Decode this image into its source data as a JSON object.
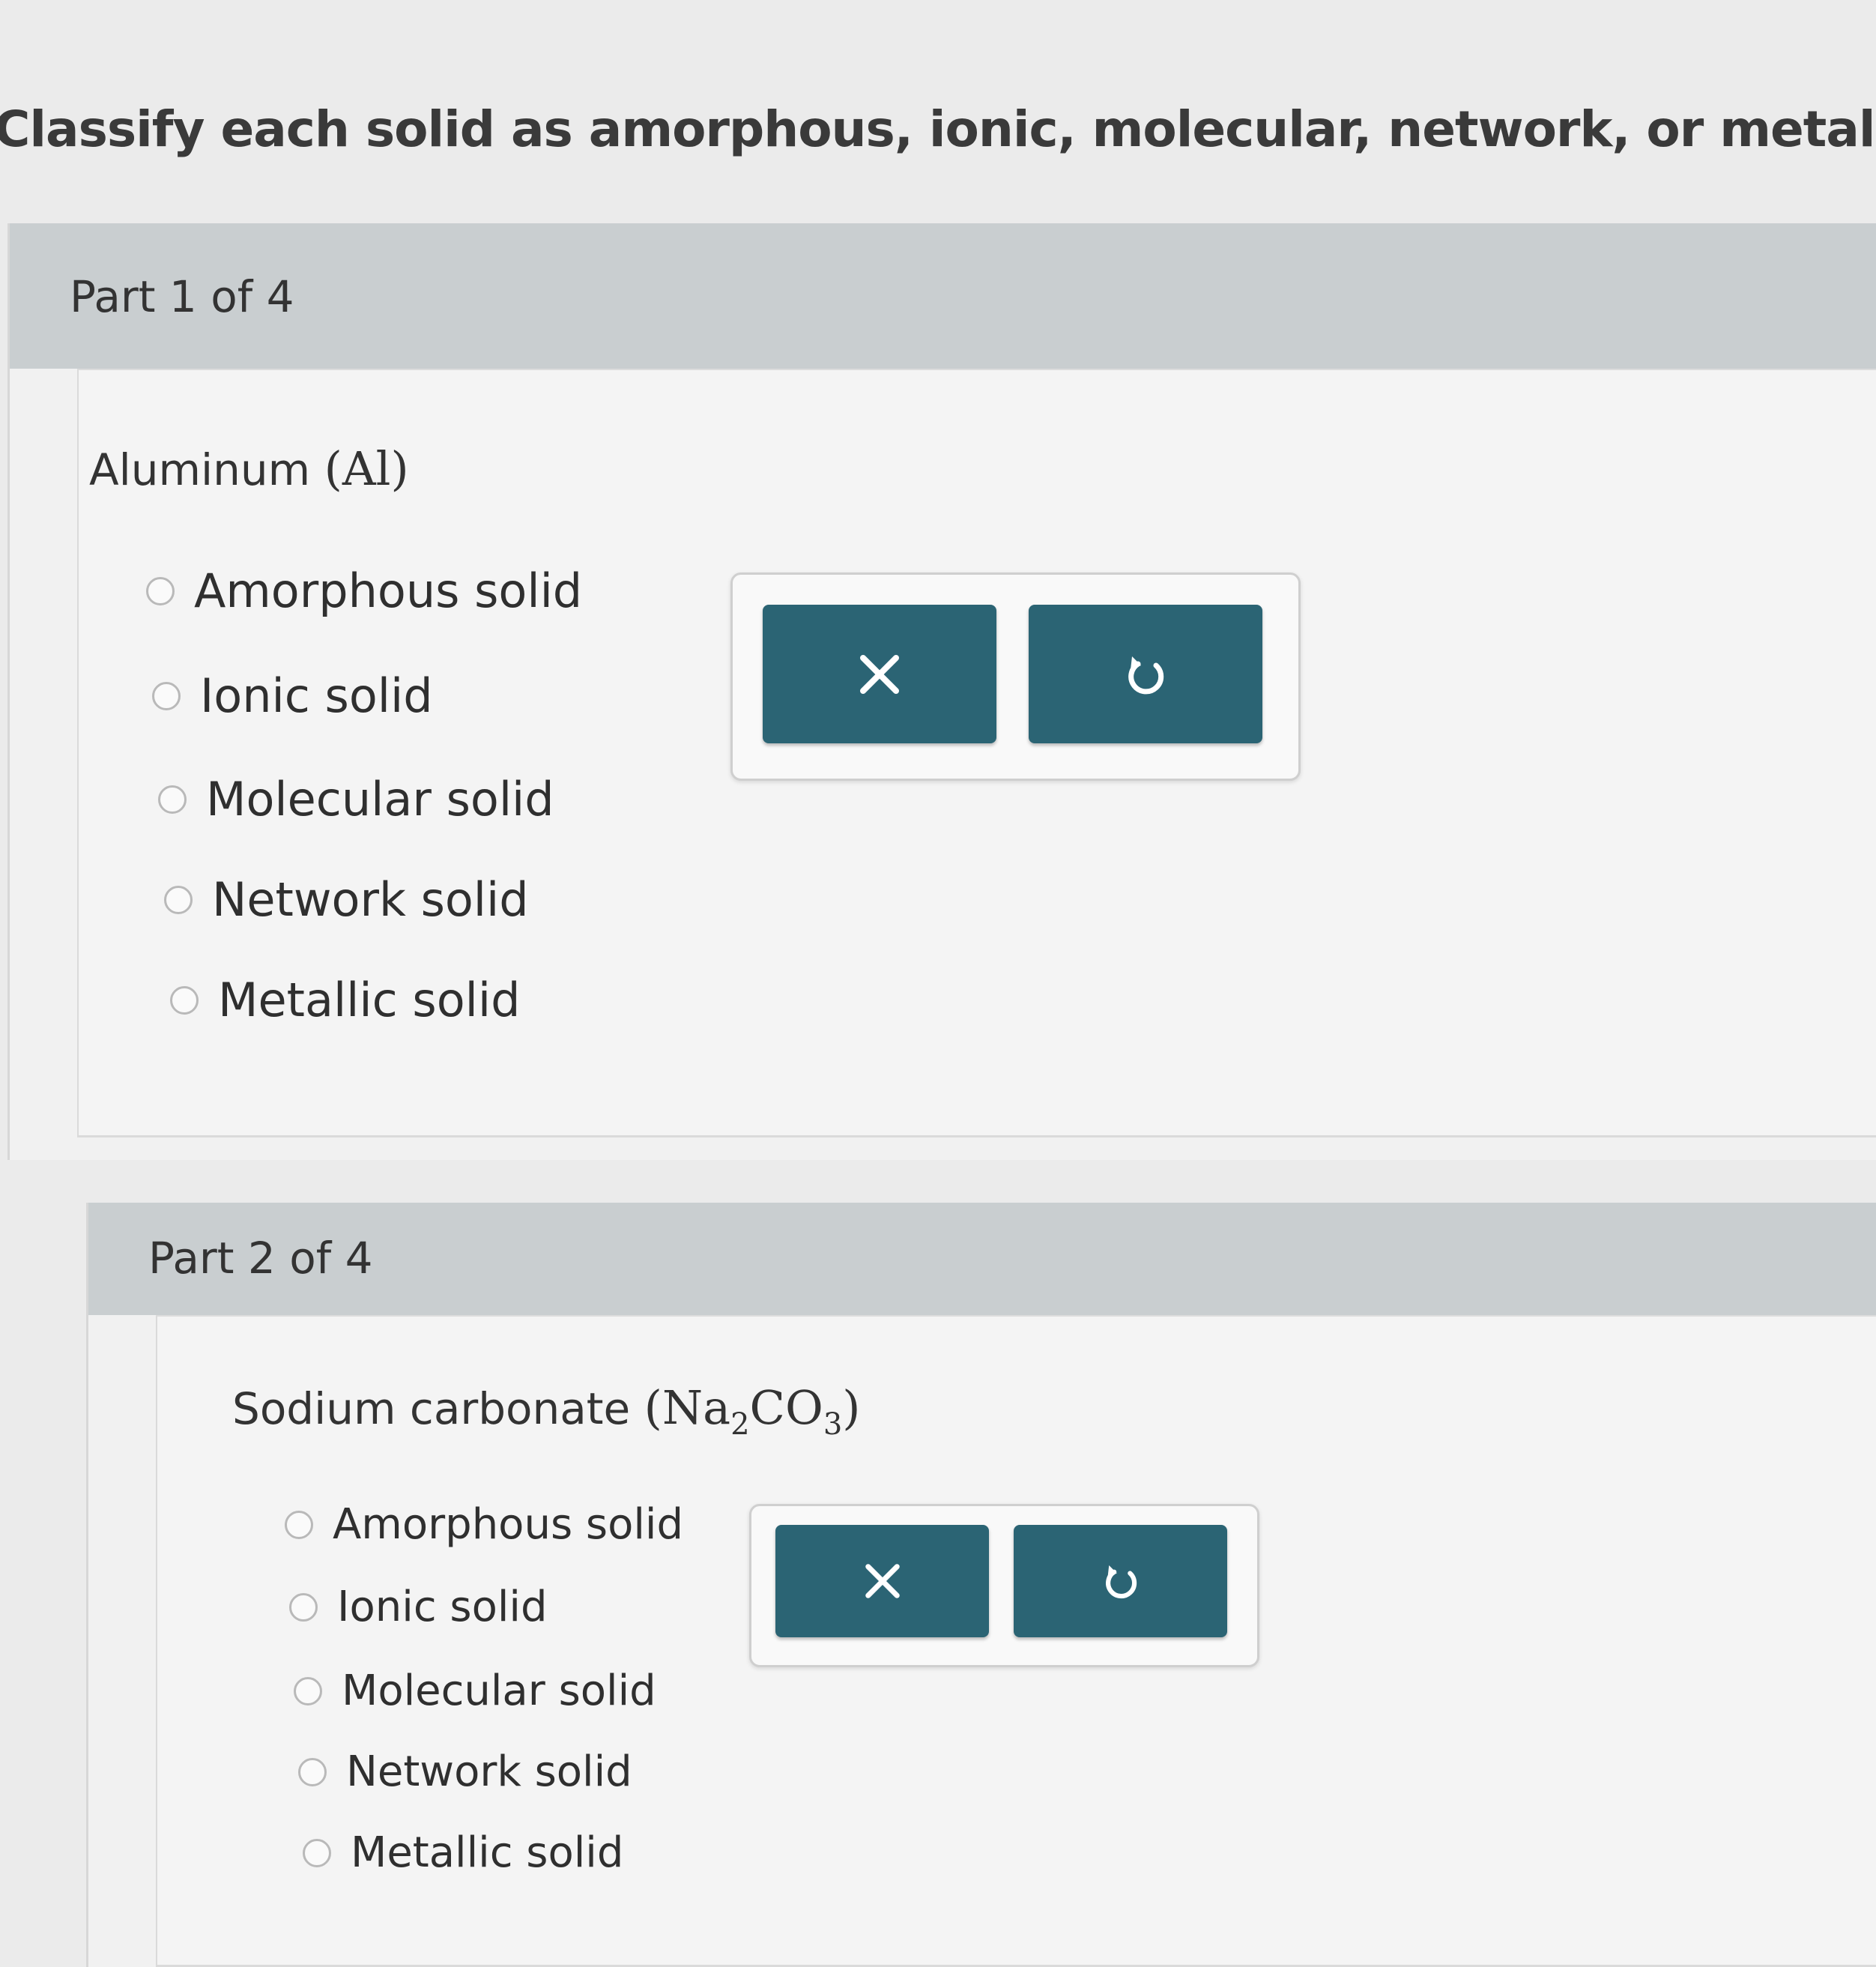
{
  "instruction": "Classify each solid as amorphous, ionic, molecular, network, or metallic. Select th",
  "parts": [
    {
      "label": "Part 1 of 4",
      "question_text": "Aluminum ",
      "formula": {
        "open": "(",
        "segments": [
          {
            "text": "Al",
            "sub": ""
          }
        ],
        "close": ")"
      },
      "options": [
        "Amorphous solid",
        "Ionic solid",
        "Molecular solid",
        "Network solid",
        "Metallic solid"
      ],
      "buttons": {
        "clear_icon": "x-icon",
        "undo_icon": "undo-icon"
      }
    },
    {
      "label": "Part 2 of 4",
      "question_text": "Sodium carbonate ",
      "formula": {
        "open": "(",
        "segments": [
          {
            "text": "Na",
            "sub": "2"
          },
          {
            "text": "CO",
            "sub": "3"
          }
        ],
        "close": ")"
      },
      "options": [
        "Amorphous solid",
        "Ionic solid",
        "Molecular solid",
        "Network solid",
        "Metallic solid"
      ],
      "buttons": {
        "clear_icon": "x-icon",
        "undo_icon": "undo-icon"
      }
    }
  ],
  "colors": {
    "button_bg": "#2b6474",
    "part_header_bg": "#c9ced0",
    "radio_border": "#b9b9b9"
  }
}
